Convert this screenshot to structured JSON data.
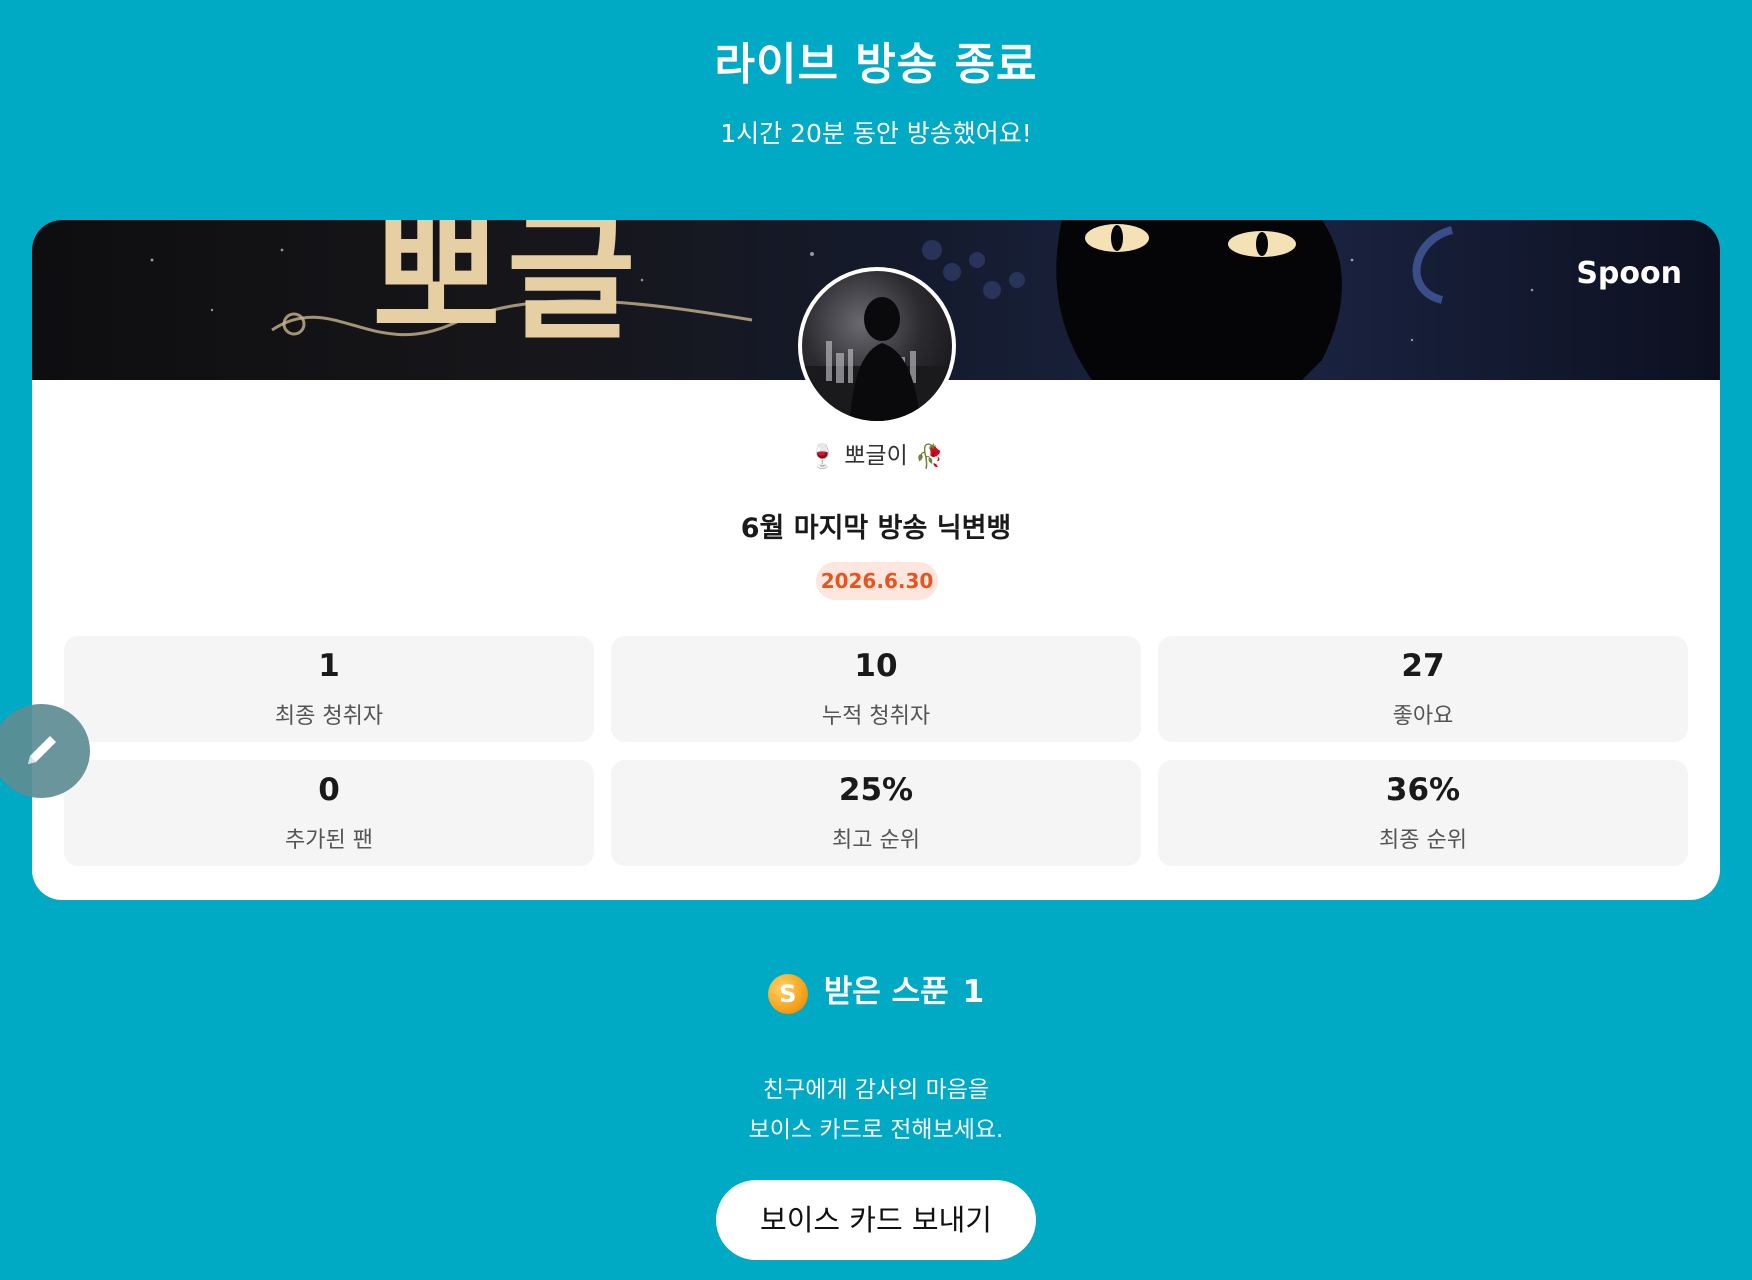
{
  "header": {
    "title": "라이브 방송 종료",
    "subtitle": "1시간 20분 동안 방송했어요!"
  },
  "card": {
    "brand": "Spoon",
    "banner_text": "뽀글",
    "nickname": "뽀글이",
    "nickname_prefix_emoji": "🍷",
    "nickname_suffix_emoji": "🥀",
    "live_title": "6월 마지막 방송 닉변뱅",
    "date": "2026.6.30",
    "stats": [
      {
        "value": "1",
        "label": "최종 청취자"
      },
      {
        "value": "10",
        "label": "누적 청취자"
      },
      {
        "value": "27",
        "label": "좋아요"
      },
      {
        "value": "0",
        "label": "추가된 팬"
      },
      {
        "value": "25%",
        "label": "최고 순위"
      },
      {
        "value": "36%",
        "label": "최종 순위"
      }
    ]
  },
  "spoons": {
    "coin_symbol": "S",
    "label": "받은 스푼",
    "count": "1"
  },
  "thanks": {
    "line1": "친구에게 감사의 마음을",
    "line2": "보이스 카드로 전해보세요."
  },
  "voice_card_button": "보이스 카드 보내기",
  "colors": {
    "background": "#00a9c4",
    "card": "#ffffff",
    "stat_box": "#f5f5f5",
    "date_badge_bg": "#fde6de",
    "date_badge_text": "#e8541d",
    "coin": "#f6a21a"
  }
}
